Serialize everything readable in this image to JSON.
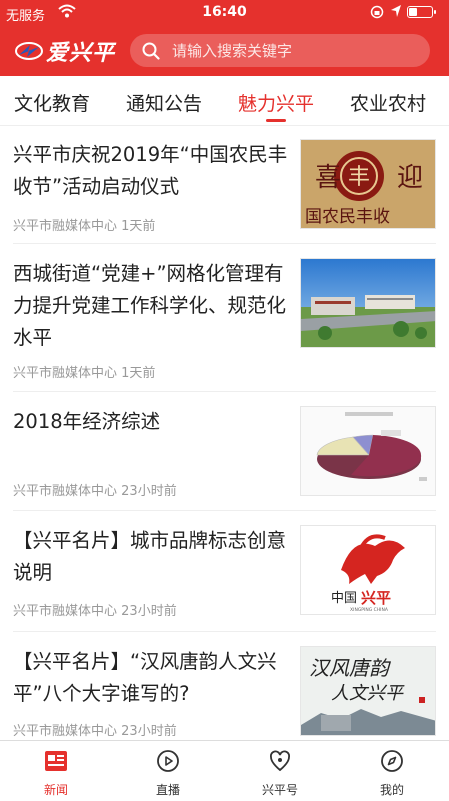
{
  "status_bar": {
    "carrier": "无服务",
    "time": "16:40"
  },
  "header": {
    "logo_text": "爱兴平",
    "search_placeholder": "请输入搜索关键字",
    "brand_color": "#e5312d"
  },
  "tabs": [
    {
      "label": "文化教育",
      "active": false
    },
    {
      "label": "通知公告",
      "active": false
    },
    {
      "label": "魅力兴平",
      "active": true
    },
    {
      "label": "农业农村",
      "active": false
    }
  ],
  "articles": [
    {
      "title": "兴平市庆祝2019年“中国农民丰收节”活动启动仪式",
      "source": "兴平市融媒体中心",
      "time": "1天前",
      "thumb_text": [
        "喜",
        "丰",
        "迎",
        "国农民丰收"
      ]
    },
    {
      "title": "西城街道“党建+”网格化管理有力提升党建工作科学化、规范化水平",
      "source": "兴平市融媒体中心",
      "time": "1天前"
    },
    {
      "title": "2018年经济综述",
      "source": "兴平市融媒体中心",
      "time": "23小时前"
    },
    {
      "title": "【兴平名片】城市品牌标志创意说明",
      "source": "兴平市融媒体中心",
      "time": "23小时前",
      "thumb_text": [
        "中国",
        "兴平",
        "XINGPING CHINA"
      ]
    },
    {
      "title": "【兴平名片】“汉风唐韵人文兴平”八个大字谁写的?",
      "source": "兴平市融媒体中心",
      "time": "23小时前",
      "thumb_text": [
        "汉风唐韵",
        "人文兴平"
      ]
    }
  ],
  "bottom_nav": [
    {
      "label": "新闻",
      "icon": "news-icon",
      "active": true
    },
    {
      "label": "直播",
      "icon": "play-icon",
      "active": false
    },
    {
      "label": "兴平号",
      "icon": "heart-person-icon",
      "active": false
    },
    {
      "label": "我的",
      "icon": "compass-icon",
      "active": false
    }
  ]
}
